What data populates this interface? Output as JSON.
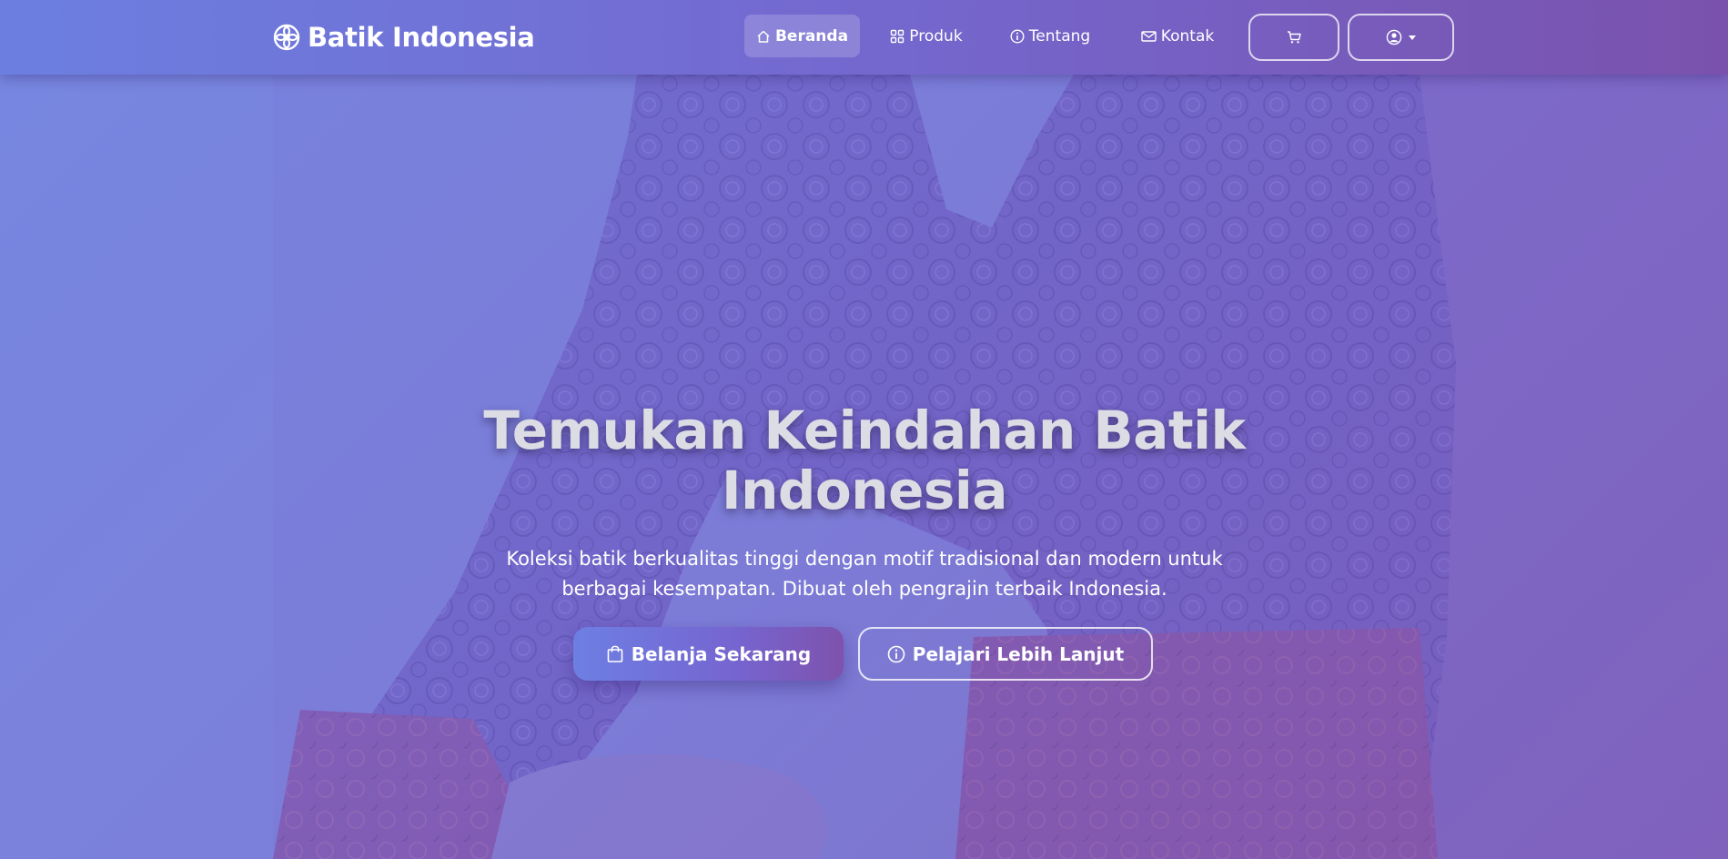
{
  "navbar": {
    "brand": "Batik Indonesia",
    "items": [
      {
        "label": "Beranda",
        "icon": "home-icon",
        "active": true
      },
      {
        "label": "Produk",
        "icon": "grid-icon",
        "active": false
      },
      {
        "label": "Tentang",
        "icon": "info-circle-icon",
        "active": false
      },
      {
        "label": "Kontak",
        "icon": "envelope-icon",
        "active": false
      }
    ],
    "cart_icon": "cart-icon",
    "user_icon": "user-circle-icon"
  },
  "hero": {
    "title_line1": "Temukan Keindahan Batik",
    "title_line2": "Indonesia",
    "subtitle_line1": "Koleksi batik berkualitas tinggi dengan motif tradisional dan modern untuk",
    "subtitle_line2": "berbagai kesempatan. Dibuat oleh pengrajin terbaik Indonesia.",
    "primary_button": "Belanja Sekarang",
    "secondary_button": "Pelajari Lebih Lanjut"
  },
  "colors": {
    "gradient_start": "#6c7fe0",
    "gradient_mid": "#7468cf",
    "gradient_end": "#7a52ad",
    "text": "#ffffff"
  }
}
